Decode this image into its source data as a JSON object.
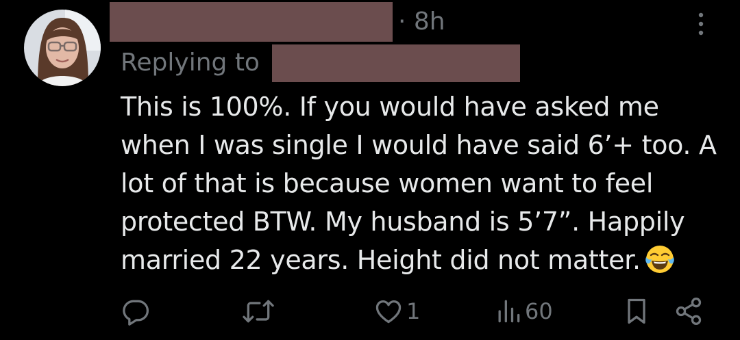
{
  "tweet": {
    "time": "· 8h",
    "replying_label": "Replying to",
    "text": "This is 100%. If you would have asked me\nwhen I was single I would have said 6’+ too. A\nlot of that is because women want to feel\nprotected BTW. My husband is 5’7”. Happily\nmarried 22 years. Height did not matter.",
    "emoji": "face-with-tears-of-joy"
  },
  "actions": {
    "reply_icon": "reply-icon",
    "retweet_icon": "retweet-icon",
    "like_icon": "heart-icon",
    "like_count": "1",
    "views_icon": "views-icon",
    "views_count": "60",
    "bookmark_icon": "bookmark-icon",
    "share_icon": "share-icon"
  },
  "colors": {
    "background": "#000000",
    "text": "#e7e9ea",
    "secondary": "#71767b",
    "redaction": "#6b4d4e"
  }
}
